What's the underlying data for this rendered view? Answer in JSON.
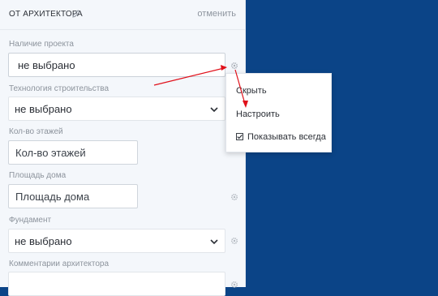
{
  "header": {
    "title": "ОТ АРХИТЕКТОРА",
    "cancel_label": "отменить"
  },
  "form": {
    "project": {
      "label": "Наличие проекта",
      "value": "не выбрано"
    },
    "technology": {
      "label": "Технология строительства",
      "value": "не выбрано"
    },
    "floors": {
      "label": "Кол-во этажей",
      "placeholder": "Кол-во этажей"
    },
    "area": {
      "label": "Площадь дома",
      "placeholder": "Площадь дома"
    },
    "foundation": {
      "label": "Фундамент",
      "value": "не выбрано"
    },
    "comments": {
      "label": "Комментарии архитектора"
    }
  },
  "context_menu": {
    "hide_label": "Скрыть",
    "configure_label": "Настроить",
    "always_show_label": "Показывать всегда",
    "always_show_checked": true
  },
  "colors": {
    "background": "#0b4487",
    "panel": "#f4f7fb",
    "annotation_arrow": "#e0101a"
  }
}
